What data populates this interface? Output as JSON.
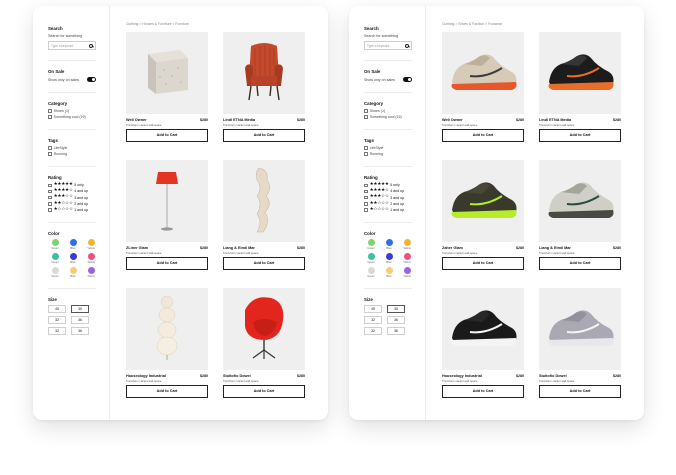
{
  "sidebar": {
    "search_title": "Search",
    "search_sub": "Search for something",
    "search_placeholder": "Type a keyword",
    "onsale_title": "On Sale",
    "onsale_label": "Show only on sales",
    "category_title": "Category",
    "categories": [
      "Shoes (1)",
      "Something cool (19)"
    ],
    "tags_title": "Tags",
    "tags": [
      "LifeStyle",
      "Running"
    ],
    "rating_title": "Rating",
    "ratings": [
      {
        "stars": "★★★★★",
        "label": "5 only"
      },
      {
        "stars": "★★★★☆",
        "label": "4 and up"
      },
      {
        "stars": "★★★☆☆",
        "label": "3 and up"
      },
      {
        "stars": "★★☆☆☆",
        "label": "2 and up"
      },
      {
        "stars": "★☆☆☆☆",
        "label": "1 and up"
      }
    ],
    "color_title": "Color",
    "colors": [
      {
        "name": "Green",
        "hex": "#7fd36b"
      },
      {
        "name": "Blue",
        "hex": "#2f6ef0"
      },
      {
        "name": "Yellow",
        "hex": "#f5b531"
      },
      {
        "name": "Green",
        "hex": "#3bbf9c"
      },
      {
        "name": "Blue",
        "hex": "#3b3bd1"
      },
      {
        "name": "Yellow",
        "hex": "#f0507a"
      },
      {
        "name": "Green",
        "hex": "#d9d9d9"
      },
      {
        "name": "Blue",
        "hex": "#f4ce72"
      },
      {
        "name": "Yellow",
        "hex": "#9a63e6"
      }
    ],
    "size_title": "Size",
    "sizes": [
      "45",
      "35",
      "32",
      "36",
      "32",
      "36"
    ]
  },
  "left": {
    "breadcrumb": "Clothing  >  Houses & Furniture  >  Furniture",
    "products": [
      {
        "name": "Well Owner",
        "desc": "Transform vacant wall space",
        "price": "$280",
        "button": "Add to Cart"
      },
      {
        "name": "Lindl ETNA Media",
        "desc": "Transform vacant wall space",
        "price": "$280",
        "button": "Add to Cart"
      },
      {
        "name": "ZLiner Glam",
        "desc": "Transform vacant wall space",
        "price": "$280",
        "button": "Add to Cart"
      },
      {
        "name": "Liang & Eimil Mar",
        "desc": "Transform vacant wall space",
        "price": "$280",
        "button": "Add to Cart"
      },
      {
        "name": "Houseology Industrial",
        "desc": "Transform vacant wall space",
        "price": "$280",
        "button": "Add to Cart"
      },
      {
        "name": "Stultofio Dowel",
        "desc": "Transform vacant wall space",
        "price": "$280",
        "button": "Add to Cart"
      }
    ]
  },
  "right": {
    "breadcrumb": "Clothing  >  Shoes & Fashion  >  Footwear",
    "products": [
      {
        "name": "Well Owner",
        "desc": "Transform vacant wall space",
        "price": "$280",
        "button": "Add to Cart"
      },
      {
        "name": "Lindl ETNA Media",
        "desc": "Transform vacant wall space",
        "price": "$280",
        "button": "Add to Cart"
      },
      {
        "name": "Zaher Glam",
        "desc": "Transform vacant wall space",
        "price": "$280",
        "button": "Add to Cart"
      },
      {
        "name": "Liang & Eimil Mar",
        "desc": "Transform vacant wall space",
        "price": "$280",
        "button": "Add to Cart"
      },
      {
        "name": "Houseology Industrial",
        "desc": "Transform vacant wall space",
        "price": "$280",
        "button": "Add to Cart"
      },
      {
        "name": "Stultofio Dowel",
        "desc": "Transform vacant wall space",
        "price": "$280",
        "button": "Add to Cart"
      }
    ]
  }
}
